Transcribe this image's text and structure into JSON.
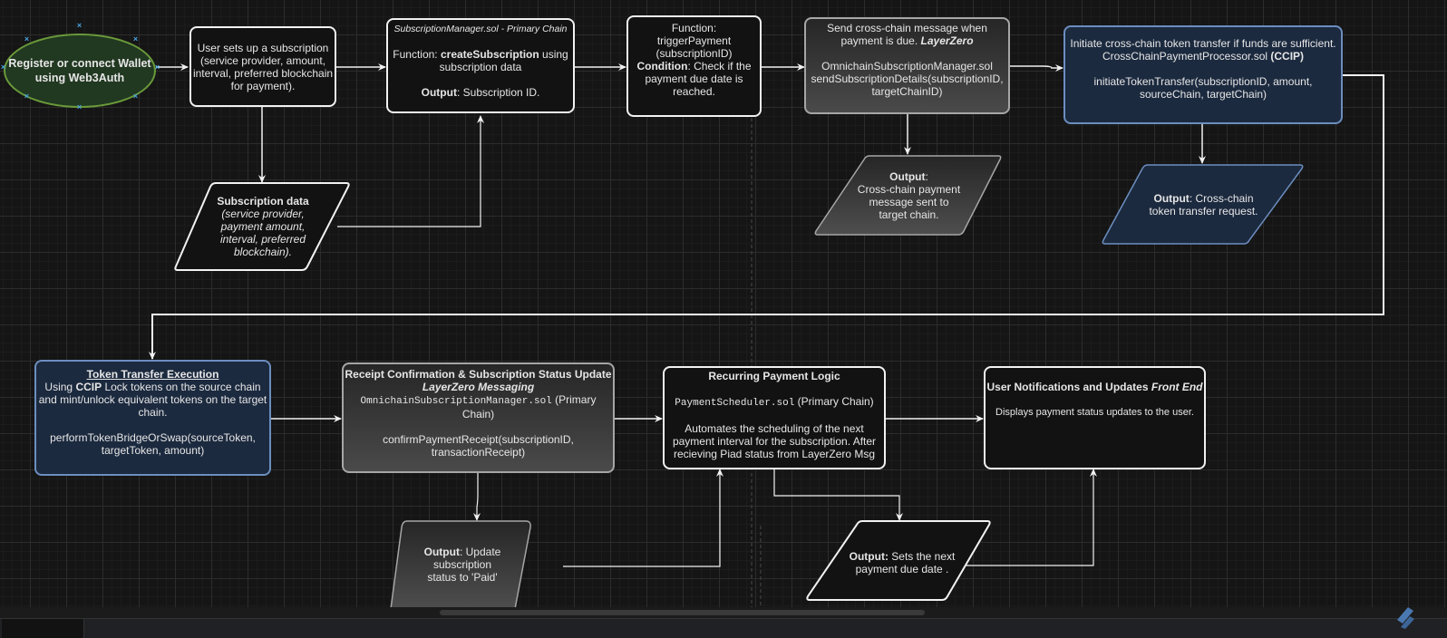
{
  "diagram": {
    "start": {
      "label_line1": "Register or connect Wallet",
      "label_line2": "using Web3Auth"
    },
    "setup": {
      "lines": [
        "User sets up a subscription",
        "(service provider, amount,",
        "interval, preferred blockchain",
        "for payment)."
      ]
    },
    "subscription_data": {
      "title": "Subscription data",
      "lines": [
        "(service provider,",
        "payment amount,",
        "interval, preferred",
        "blockchain)."
      ]
    },
    "subscription_manager": {
      "header": "SubscriptionManager.sol - Primary Chain",
      "func_prefix": "Function: ",
      "func_name": "createSubscription",
      "func_suffix": " using",
      "func_line2": "subscription data",
      "output_label": "Output",
      "output_text": ": Subscription ID."
    },
    "trigger_payment": {
      "line1": "Function:",
      "line2": "triggerPayment",
      "line3": "(subscriptionID)",
      "condition_label": "Condition",
      "condition_text": ": Check if the",
      "line5": "payment due date is",
      "line6": "reached."
    },
    "send_message": {
      "line1": "Send cross-chain message when",
      "line2_prefix": "payment is due. ",
      "line2_italic": "LayerZero",
      "line3": "OmnichainSubscriptionManager.sol",
      "line4": "sendSubscriptionDetails(subscriptionID,",
      "line5": "targetChainID)"
    },
    "message_output": {
      "label": "Output",
      "suffix": ":",
      "lines": [
        "Cross-chain payment",
        "message sent to",
        "target chain."
      ]
    },
    "initiate_transfer": {
      "line1": "Initiate cross-chain token transfer if funds are sufficient.",
      "line2_prefix": "CrossChainPaymentProcessor.sol ",
      "line2_bold": "(CCIP)",
      "line3": "initiateTokenTransfer(subscriptionID, amount,",
      "line4": "sourceChain, targetChain)"
    },
    "transfer_output": {
      "label": "Output",
      "text": ": Cross-chain",
      "line2": "token transfer request."
    },
    "token_execution": {
      "title": "Token Transfer Execution",
      "line1_prefix": "Using ",
      "line1_bold": "CCIP",
      "line1_suffix": " Lock tokens on the source chain",
      "line2": "and mint/unlock equivalent tokens on the target",
      "line3": "chain.",
      "line4": "performTokenBridgeOrSwap(sourceToken,",
      "line5": "targetToken, amount)"
    },
    "receipt_confirmation": {
      "title": "Receipt Confirmation & Subscription Status Update",
      "subtitle": "LayerZero Messaging",
      "contract": "OmnichainSubscriptionManager.sol",
      "contract_suffix": " (Primary",
      "line4": "Chain)",
      "line5": "confirmPaymentReceipt(subscriptionID,",
      "line6": "transactionReceipt)"
    },
    "receipt_output": {
      "label": "Output",
      "text": ": Update subscription",
      "line2": "status to 'Paid'"
    },
    "recurring": {
      "title": "Recurring Payment Logic",
      "contract": "PaymentScheduler.sol",
      "contract_suffix": " (Primary Chain)",
      "line3": "Automates the scheduling of the next",
      "line4": "payment interval for the subscription. After",
      "line5": "recieving Piad status from LayerZero Msg"
    },
    "recurring_output": {
      "label": "Output:",
      "text": " Sets the next",
      "line2": "payment due date ."
    },
    "notifications": {
      "title": "User Notifications and Updates ",
      "title_italic": "Front End",
      "line2": "Displays payment status updates to the user."
    }
  },
  "colors": {
    "background": "#151515",
    "edge": "#f2f2f2",
    "start_fill": "#213821",
    "start_stroke": "#6a9a3a",
    "navy_fill": "#1c2a3f",
    "navy_stroke": "#6c8ebf",
    "grey_stroke": "#a6a6a6",
    "handle": "#4aa3df"
  }
}
